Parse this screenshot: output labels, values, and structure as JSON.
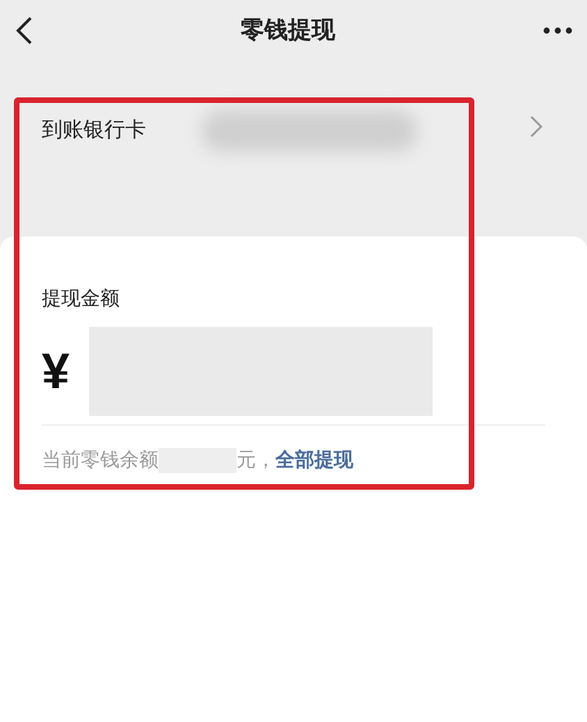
{
  "nav_bar": {
    "title": "零钱提现"
  },
  "bank_card_row": {
    "label": "到账银行卡"
  },
  "amount": {
    "label": "提现金额",
    "currency": "¥"
  },
  "balance": {
    "prefix": "当前零钱余额",
    "suffix": "元，",
    "link": "全部提现"
  }
}
